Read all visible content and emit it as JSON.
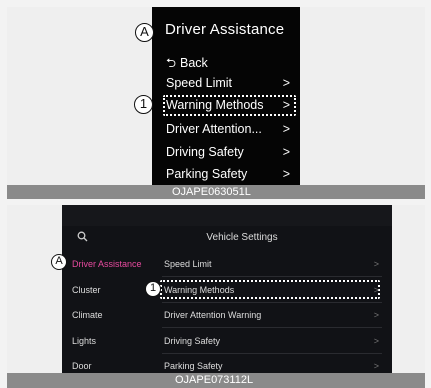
{
  "top": {
    "callout_a": "A",
    "callout_1": "1",
    "title": "Driver Assistance",
    "back_arrow": "⮌",
    "back_label": "Back",
    "items": [
      {
        "label": "Speed Limit",
        "chev": ">"
      },
      {
        "label": "Warning Methods",
        "chev": ">"
      },
      {
        "label": "Driver Attention...",
        "chev": ">"
      },
      {
        "label": "Driving Safety",
        "chev": ">"
      },
      {
        "label": "Parking Safety",
        "chev": ">"
      }
    ],
    "caption": "OJAPE063051L"
  },
  "bottom": {
    "callout_a": "A",
    "callout_1": "1",
    "search_icon": "🔍",
    "title": "Vehicle Settings",
    "sidebar": [
      {
        "label": "Driver Assistance"
      },
      {
        "label": "Cluster"
      },
      {
        "label": "Climate"
      },
      {
        "label": "Lights"
      },
      {
        "label": "Door"
      }
    ],
    "items": [
      {
        "label": "Speed Limit",
        "chev": ">"
      },
      {
        "label": "Warning Methods",
        "chev": ">"
      },
      {
        "label": "Driver Attention Warning",
        "chev": ">"
      },
      {
        "label": "Driving Safety",
        "chev": ">"
      },
      {
        "label": "Parking Safety",
        "chev": ">"
      }
    ],
    "caption": "OJAPE073112L"
  },
  "colors": {
    "screen": "#050505",
    "active_accent": "#e64a9e",
    "caption_bar": "#8a8a8a"
  }
}
